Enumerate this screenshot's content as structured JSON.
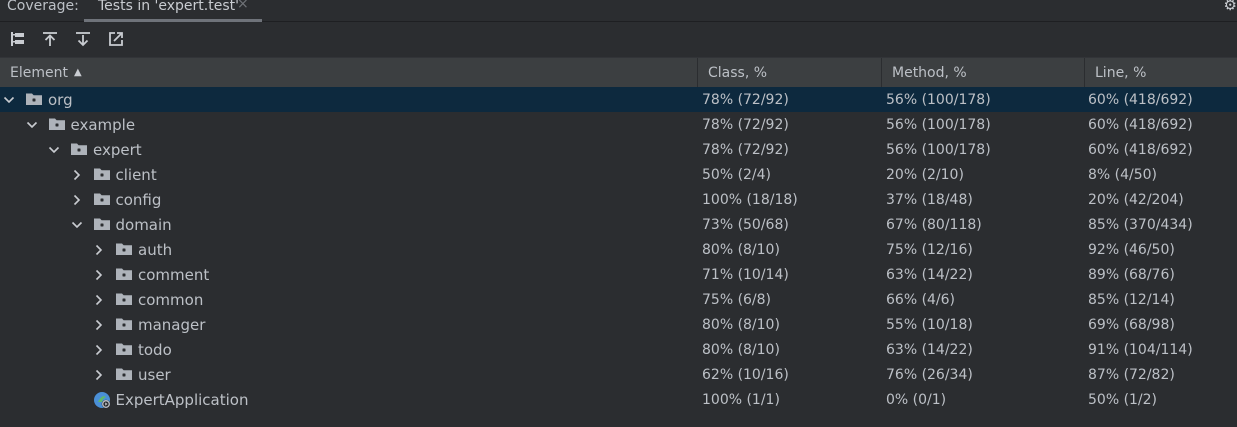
{
  "tabbar": {
    "title": "Coverage:",
    "tab_label": "Tests in 'expert.test'",
    "close_glyph": "×",
    "settings_icon": "gear-icon"
  },
  "toolbar": {
    "icons": [
      "flatten-packages-icon",
      "import-icon",
      "export-icon",
      "open-in-editor-icon"
    ]
  },
  "table": {
    "columns": {
      "element": "Element",
      "class": "Class, %",
      "method": "Method, %",
      "line": "Line, %"
    },
    "rows": [
      {
        "name": "org",
        "depth": 0,
        "expanded": true,
        "class": "78% (72/92)",
        "method": "56% (100/178)",
        "line": "60% (418/692)"
      },
      {
        "name": "example",
        "depth": 1,
        "expanded": true,
        "class": "78% (72/92)",
        "method": "56% (100/178)",
        "line": "60% (418/692)"
      },
      {
        "name": "expert",
        "depth": 2,
        "expanded": true,
        "class": "78% (72/92)",
        "method": "56% (100/178)",
        "line": "60% (418/692)"
      },
      {
        "name": "client",
        "depth": 3,
        "expanded": false,
        "class": "50% (2/4)",
        "method": "20% (2/10)",
        "line": "8% (4/50)"
      },
      {
        "name": "config",
        "depth": 3,
        "expanded": false,
        "class": "100% (18/18)",
        "method": "37% (18/48)",
        "line": "20% (42/204)"
      },
      {
        "name": "domain",
        "depth": 3,
        "expanded": true,
        "class": "73% (50/68)",
        "method": "67% (80/118)",
        "line": "85% (370/434)"
      },
      {
        "name": "auth",
        "depth": 4,
        "expanded": false,
        "class": "80% (8/10)",
        "method": "75% (12/16)",
        "line": "92% (46/50)"
      },
      {
        "name": "comment",
        "depth": 4,
        "expanded": false,
        "class": "71% (10/14)",
        "method": "63% (14/22)",
        "line": "89% (68/76)"
      },
      {
        "name": "common",
        "depth": 4,
        "expanded": false,
        "class": "75% (6/8)",
        "method": "66% (4/6)",
        "line": "85% (12/14)"
      },
      {
        "name": "manager",
        "depth": 4,
        "expanded": false,
        "class": "80% (8/10)",
        "method": "55% (10/18)",
        "line": "69% (68/98)"
      },
      {
        "name": "todo",
        "depth": 4,
        "expanded": false,
        "class": "80% (8/10)",
        "method": "63% (14/22)",
        "line": "91% (104/114)"
      },
      {
        "name": "user",
        "depth": 4,
        "expanded": false,
        "class": "62% (10/16)",
        "method": "76% (26/34)",
        "line": "87% (72/82)"
      },
      {
        "name": "ExpertApplication",
        "depth": 3,
        "leaf": true,
        "class": "100% (1/1)",
        "method": "0% (0/1)",
        "line": "50% (1/2)"
      }
    ]
  },
  "colors": {
    "background": "#2b2d30",
    "header": "#3c3f41",
    "selected_row": "#0d293e",
    "text": "#bcc0c6",
    "folder_icon": "#aeb3ba",
    "app_icon_blue": "#4a8fd6",
    "app_icon_green": "#5fb86b"
  }
}
